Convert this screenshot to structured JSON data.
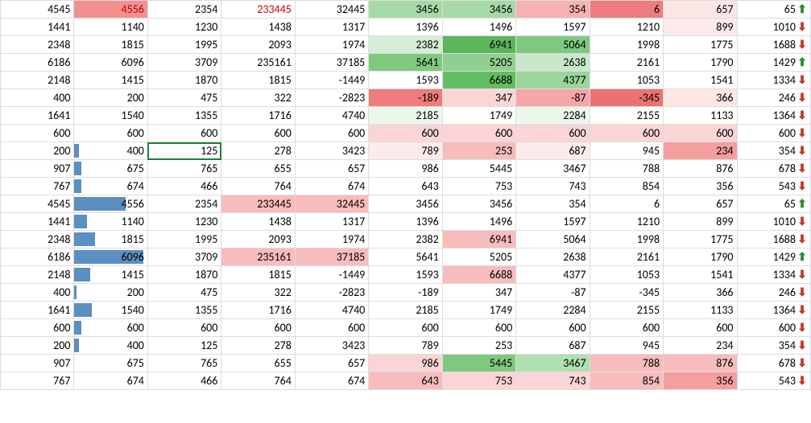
{
  "chart_data": {
    "type": "table",
    "columns": 11,
    "rows": [
      {
        "cells": [
          {
            "v": 4545
          },
          {
            "v": 4556,
            "bg": "#f38f8f",
            "fg": "#c00000"
          },
          {
            "v": 2354
          },
          {
            "v": 233445,
            "fg": "#c00000"
          },
          {
            "v": 32445
          },
          {
            "v": 3456,
            "bg": "#a7d9a7"
          },
          {
            "v": 3456,
            "bg": "#a7d9a7"
          },
          {
            "v": 354,
            "bg": "#f6b2b2"
          },
          {
            "v": 6,
            "bg": "#ee7c7c"
          },
          {
            "v": 657,
            "bg": "#fde6e6"
          },
          {
            "v": 65,
            "icon": "up"
          }
        ]
      },
      {
        "cells": [
          {
            "v": 1441
          },
          {
            "v": 1140
          },
          {
            "v": 1230
          },
          {
            "v": 1438
          },
          {
            "v": 1317
          },
          {
            "v": 1396
          },
          {
            "v": 1496
          },
          {
            "v": 1597
          },
          {
            "v": 1210
          },
          {
            "v": 899,
            "bg": "#fdeaea"
          },
          {
            "v": 1010,
            "icon": "down"
          }
        ]
      },
      {
        "cells": [
          {
            "v": 2348
          },
          {
            "v": 1815
          },
          {
            "v": 1995
          },
          {
            "v": 2093
          },
          {
            "v": 1974
          },
          {
            "v": 2382,
            "bg": "#d6edd6"
          },
          {
            "v": 6941,
            "bg": "#5bb65b"
          },
          {
            "v": 5064,
            "bg": "#7fc97f"
          },
          {
            "v": 1998
          },
          {
            "v": 1775
          },
          {
            "v": 1688,
            "icon": "down"
          }
        ]
      },
      {
        "cells": [
          {
            "v": 6186
          },
          {
            "v": 6096
          },
          {
            "v": 3709
          },
          {
            "v": 235161
          },
          {
            "v": 37185
          },
          {
            "v": 5641,
            "bg": "#7fc97f"
          },
          {
            "v": 5205,
            "bg": "#8fd08f"
          },
          {
            "v": 2638,
            "bg": "#c9e8c9"
          },
          {
            "v": 2161
          },
          {
            "v": 1790
          },
          {
            "v": 1429,
            "icon": "up"
          }
        ]
      },
      {
        "cells": [
          {
            "v": 2148
          },
          {
            "v": 1415
          },
          {
            "v": 1870
          },
          {
            "v": 1815
          },
          {
            "v": -1449
          },
          {
            "v": 1593
          },
          {
            "v": 6688,
            "bg": "#63bd63"
          },
          {
            "v": 4377,
            "bg": "#9ad69a"
          },
          {
            "v": 1053
          },
          {
            "v": 1541
          },
          {
            "v": 1334,
            "icon": "down"
          }
        ]
      },
      {
        "cells": [
          {
            "v": 400
          },
          {
            "v": 200
          },
          {
            "v": 475
          },
          {
            "v": 322
          },
          {
            "v": -2823
          },
          {
            "v": -189,
            "bg": "#ee7c7c"
          },
          {
            "v": 347,
            "bg": "#fbd5d5"
          },
          {
            "v": -87,
            "bg": "#f5a6a6"
          },
          {
            "v": -345,
            "bg": "#ec7272"
          },
          {
            "v": 366,
            "bg": "#fde6e6"
          },
          {
            "v": 246,
            "icon": "down"
          }
        ]
      },
      {
        "cells": [
          {
            "v": 1641
          },
          {
            "v": 1540
          },
          {
            "v": 1355
          },
          {
            "v": 1716
          },
          {
            "v": 4740
          },
          {
            "v": 2185,
            "bg": "#ecf7ec"
          },
          {
            "v": 1749
          },
          {
            "v": 2284,
            "bg": "#ecf7ec"
          },
          {
            "v": 2155
          },
          {
            "v": 1133
          },
          {
            "v": 1364,
            "icon": "down"
          }
        ]
      },
      {
        "cells": [
          {
            "v": 600
          },
          {
            "v": 600
          },
          {
            "v": 600
          },
          {
            "v": 600
          },
          {
            "v": 600
          },
          {
            "v": 600,
            "bg": "#fbd5d5"
          },
          {
            "v": 600,
            "bg": "#fbd5d5"
          },
          {
            "v": 600,
            "bg": "#fbd5d5"
          },
          {
            "v": 600,
            "bg": "#fbd5d5"
          },
          {
            "v": 600,
            "bg": "#fbd5d5"
          },
          {
            "v": 600,
            "icon": "down"
          }
        ]
      },
      {
        "cells": [
          {
            "v": 200
          },
          {
            "v": 400,
            "bar": 6
          },
          {
            "v": 125,
            "current": true
          },
          {
            "v": 278
          },
          {
            "v": 3423
          },
          {
            "v": 789,
            "bg": "#fdeaea"
          },
          {
            "v": 253,
            "bg": "#f8bcbc"
          },
          {
            "v": 687,
            "bg": "#fdeaea"
          },
          {
            "v": 945
          },
          {
            "v": 234,
            "bg": "#f59e9e"
          },
          {
            "v": 354,
            "icon": "down"
          }
        ]
      },
      {
        "cells": [
          {
            "v": 907
          },
          {
            "v": 675,
            "bar": 10
          },
          {
            "v": 765
          },
          {
            "v": 655
          },
          {
            "v": 657
          },
          {
            "v": 986
          },
          {
            "v": 5445
          },
          {
            "v": 3467
          },
          {
            "v": 788
          },
          {
            "v": 876
          },
          {
            "v": 678,
            "icon": "down"
          }
        ]
      },
      {
        "cells": [
          {
            "v": 767
          },
          {
            "v": 674,
            "bar": 10
          },
          {
            "v": 466
          },
          {
            "v": 764
          },
          {
            "v": 674
          },
          {
            "v": 643
          },
          {
            "v": 753
          },
          {
            "v": 743
          },
          {
            "v": 854
          },
          {
            "v": 356
          },
          {
            "v": 543,
            "icon": "down"
          }
        ]
      },
      {
        "cells": [
          {
            "v": 4545
          },
          {
            "v": 4556,
            "bar": 70
          },
          {
            "v": 2354
          },
          {
            "v": 233445,
            "bg": "#f8bcbc"
          },
          {
            "v": 32445,
            "bg": "#f8bcbc"
          },
          {
            "v": 3456
          },
          {
            "v": 3456
          },
          {
            "v": 354
          },
          {
            "v": 6
          },
          {
            "v": 657
          },
          {
            "v": 65,
            "icon": "up"
          }
        ]
      },
      {
        "cells": [
          {
            "v": 1441
          },
          {
            "v": 1140,
            "bar": 17
          },
          {
            "v": 1230
          },
          {
            "v": 1438
          },
          {
            "v": 1317
          },
          {
            "v": 1396
          },
          {
            "v": 1496
          },
          {
            "v": 1597
          },
          {
            "v": 1210
          },
          {
            "v": 899
          },
          {
            "v": 1010,
            "icon": "down"
          }
        ]
      },
      {
        "cells": [
          {
            "v": 2348
          },
          {
            "v": 1815,
            "bar": 28
          },
          {
            "v": 1995
          },
          {
            "v": 2093
          },
          {
            "v": 1974
          },
          {
            "v": 2382
          },
          {
            "v": 6941,
            "bg": "#f8bcbc"
          },
          {
            "v": 5064
          },
          {
            "v": 1998
          },
          {
            "v": 1775
          },
          {
            "v": 1688,
            "icon": "down"
          }
        ]
      },
      {
        "cells": [
          {
            "v": 6186
          },
          {
            "v": 6096,
            "bar": 95
          },
          {
            "v": 3709
          },
          {
            "v": 235161,
            "bg": "#f8bcbc"
          },
          {
            "v": 37185,
            "bg": "#f8bcbc"
          },
          {
            "v": 5641
          },
          {
            "v": 5205
          },
          {
            "v": 2638
          },
          {
            "v": 2161
          },
          {
            "v": 1790
          },
          {
            "v": 1429,
            "icon": "up"
          }
        ]
      },
      {
        "cells": [
          {
            "v": 2148
          },
          {
            "v": 1415,
            "bar": 22
          },
          {
            "v": 1870
          },
          {
            "v": 1815
          },
          {
            "v": -1449
          },
          {
            "v": 1593
          },
          {
            "v": 6688,
            "bg": "#f8bcbc"
          },
          {
            "v": 4377
          },
          {
            "v": 1053
          },
          {
            "v": 1541
          },
          {
            "v": 1334,
            "icon": "down"
          }
        ]
      },
      {
        "cells": [
          {
            "v": 400
          },
          {
            "v": 200,
            "bar": 3
          },
          {
            "v": 475
          },
          {
            "v": 322
          },
          {
            "v": -2823
          },
          {
            "v": -189
          },
          {
            "v": 347
          },
          {
            "v": -87
          },
          {
            "v": -345
          },
          {
            "v": 366
          },
          {
            "v": 246,
            "icon": "down"
          }
        ]
      },
      {
        "cells": [
          {
            "v": 1641
          },
          {
            "v": 1540,
            "bar": 24
          },
          {
            "v": 1355
          },
          {
            "v": 1716
          },
          {
            "v": 4740
          },
          {
            "v": 2185
          },
          {
            "v": 1749
          },
          {
            "v": 2284
          },
          {
            "v": 2155
          },
          {
            "v": 1133
          },
          {
            "v": 1364,
            "icon": "down"
          }
        ]
      },
      {
        "cells": [
          {
            "v": 600
          },
          {
            "v": 600,
            "bar": 9
          },
          {
            "v": 600
          },
          {
            "v": 600
          },
          {
            "v": 600
          },
          {
            "v": 600
          },
          {
            "v": 600
          },
          {
            "v": 600
          },
          {
            "v": 600
          },
          {
            "v": 600
          },
          {
            "v": 600,
            "icon": "down"
          }
        ]
      },
      {
        "cells": [
          {
            "v": 200
          },
          {
            "v": 400,
            "bar": 6
          },
          {
            "v": 125
          },
          {
            "v": 278
          },
          {
            "v": 3423
          },
          {
            "v": 789
          },
          {
            "v": 253
          },
          {
            "v": 687
          },
          {
            "v": 945
          },
          {
            "v": 234
          },
          {
            "v": 354,
            "icon": "down"
          }
        ]
      },
      {
        "cells": [
          {
            "v": 907
          },
          {
            "v": 675
          },
          {
            "v": 765
          },
          {
            "v": 655
          },
          {
            "v": 657
          },
          {
            "v": 986,
            "bg": "#fbd5d5"
          },
          {
            "v": 5445,
            "bg": "#7fc97f"
          },
          {
            "v": 3467,
            "bg": "#b0dfb0"
          },
          {
            "v": 788,
            "bg": "#f8bcbc"
          },
          {
            "v": 876,
            "bg": "#f8bcbc"
          },
          {
            "v": 678,
            "icon": "down"
          }
        ]
      },
      {
        "cells": [
          {
            "v": 767
          },
          {
            "v": 674
          },
          {
            "v": 466
          },
          {
            "v": 764
          },
          {
            "v": 674
          },
          {
            "v": 643,
            "bg": "#f8bcbc"
          },
          {
            "v": 753,
            "bg": "#fbd5d5"
          },
          {
            "v": 743,
            "bg": "#fbd5d5"
          },
          {
            "v": 854,
            "bg": "#f8bcbc"
          },
          {
            "v": 356,
            "bg": "#f59e9e"
          },
          {
            "v": 543,
            "icon": "down"
          }
        ]
      }
    ]
  }
}
